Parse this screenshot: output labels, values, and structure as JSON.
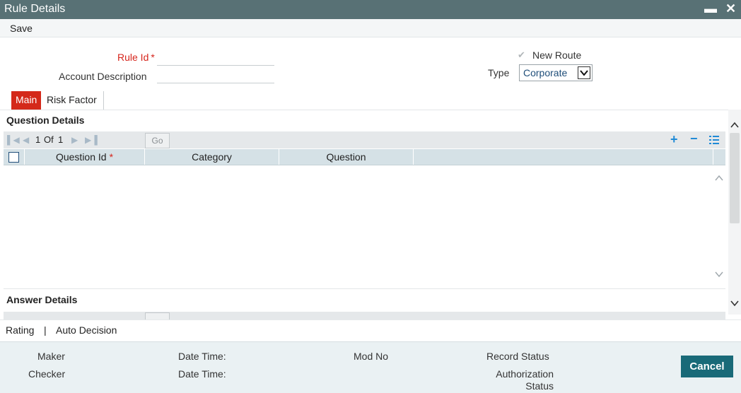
{
  "window": {
    "title": "Rule Details",
    "minimize_glyph": "▬",
    "close_glyph": "✕"
  },
  "toolbar": {
    "save_label": "Save"
  },
  "form": {
    "rule_id_label": "Rule Id",
    "required_mark": "*",
    "rule_id_value": "",
    "account_description_label": "Account Description",
    "account_description_value": "",
    "new_route_label": "New Route",
    "new_route_checked": true,
    "type_label": "Type",
    "type_value": "Corporate"
  },
  "tabs": [
    {
      "label": "Main",
      "active": true
    },
    {
      "label": "Risk Factor",
      "active": false
    }
  ],
  "question_details": {
    "title": "Question Details",
    "pager": {
      "current": "1",
      "of_label": "Of",
      "total": "1",
      "go_label": "Go"
    },
    "columns": [
      {
        "label": "Question Id",
        "required": true
      },
      {
        "label": "Category",
        "required": false
      },
      {
        "label": "Question",
        "required": false
      }
    ],
    "rows": []
  },
  "answer_details": {
    "title": "Answer Details"
  },
  "footer_links": {
    "rating": "Rating",
    "separator": "|",
    "auto_decision": "Auto Decision"
  },
  "audit": {
    "maker": "Maker",
    "checker": "Checker",
    "date_time_1": "Date Time:",
    "date_time_2": "Date Time:",
    "mod_no": "Mod No",
    "record_status": "Record Status",
    "authorization_status": "Authorization Status"
  },
  "buttons": {
    "cancel": "Cancel"
  },
  "colors": {
    "titlebar": "#587175",
    "accent_red": "#d4291a",
    "cancel": "#196a78",
    "icon_blue": "#1f8ad6"
  }
}
